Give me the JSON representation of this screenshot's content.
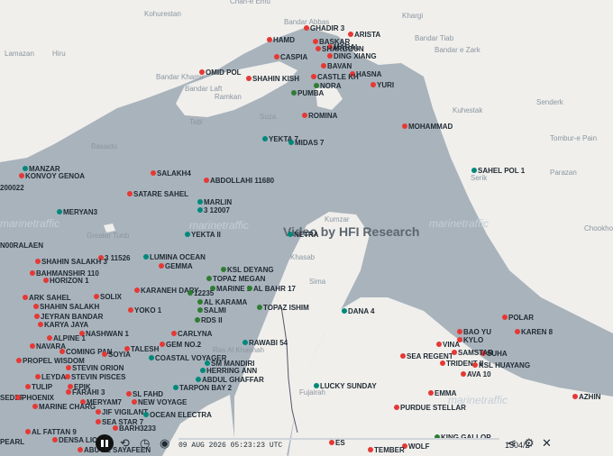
{
  "place_names": [
    "Chah-e Emu",
    "Kohurestan",
    "Lamazan",
    "Hiru",
    "Bandar Abbas",
    "Bandar Khamir",
    "Bandar Laft",
    "Ramkan",
    "Suza",
    "Tabl",
    "Basaidu",
    "Greater Tunb",
    "Khargi",
    "Bandar Tiab",
    "Bandar e Zark",
    "Kuhestak",
    "Senderk",
    "Tombur-e Pain",
    "Parazan",
    "Serik",
    "Kumzar",
    "Khasab",
    "Sima",
    "Ras Al Khaimah",
    "Fujairah",
    "Chookhor"
  ],
  "overlay": {
    "title": "Video by HFI Research",
    "watermark": "marinetraffic"
  },
  "ships": [
    {
      "name": "GHADIR 3",
      "color": "#e53935"
    },
    {
      "name": "ARISTA",
      "color": "#e53935"
    },
    {
      "name": "HAMD",
      "color": "#e53935"
    },
    {
      "name": "BASKAR",
      "color": "#e53935"
    },
    {
      "name": "MARAL",
      "color": "#e53935"
    },
    {
      "name": "SHARGOUN",
      "color": "#e53935"
    },
    {
      "name": "CASPIA",
      "color": "#e53935"
    },
    {
      "name": "DING XIANG",
      "color": "#e53935"
    },
    {
      "name": "BAVAN",
      "color": "#e53935"
    },
    {
      "name": "OMID POL",
      "color": "#e53935"
    },
    {
      "name": "HASNA",
      "color": "#e53935"
    },
    {
      "name": "SHAHIN KISH",
      "color": "#e53935"
    },
    {
      "name": "CASTLE KH",
      "color": "#e53935"
    },
    {
      "name": "YURI",
      "color": "#e53935"
    },
    {
      "name": "NORA",
      "color": "#2e7d32"
    },
    {
      "name": "PUMBA",
      "color": "#2e7d32"
    },
    {
      "name": "ROMINA",
      "color": "#e53935"
    },
    {
      "name": "MOHAMMAD",
      "color": "#e53935"
    },
    {
      "name": "YEKTA 7",
      "color": "#00897b"
    },
    {
      "name": "MIDAS 7",
      "color": "#00897b"
    },
    {
      "name": "MANZAR",
      "color": "#00897b"
    },
    {
      "name": "KONVOY GENOA",
      "color": "#e53935"
    },
    {
      "name": "200022",
      "color": "#00897b"
    },
    {
      "name": "SALAKH4",
      "color": "#e53935"
    },
    {
      "name": "ABDOLLAHI 11680",
      "color": "#e53935"
    },
    {
      "name": "SAHEL POL 1",
      "color": "#00897b"
    },
    {
      "name": "SATARE SAHEL",
      "color": "#e53935"
    },
    {
      "name": "MARLIN",
      "color": "#00897b"
    },
    {
      "name": "3 12007",
      "color": "#00897b"
    },
    {
      "name": "MERYAN3",
      "color": "#00897b"
    },
    {
      "name": "YEKTA II",
      "color": "#00897b"
    },
    {
      "name": "NETRA",
      "color": "#00897b"
    },
    {
      "name": "N00RALAEN",
      "color": "#e53935"
    },
    {
      "name": "3 11526",
      "color": "#e53935"
    },
    {
      "name": "LUMINA OCEAN",
      "color": "#00897b"
    },
    {
      "name": "GEMMA",
      "color": "#e53935"
    },
    {
      "name": "SHAHIN SALAKH 3",
      "color": "#e53935"
    },
    {
      "name": "BAHMANSHIR 110",
      "color": "#e53935"
    },
    {
      "name": "HORIZON 1",
      "color": "#e53935"
    },
    {
      "name": "KSL DEYANG",
      "color": "#2e7d32"
    },
    {
      "name": "TOPAZ MEGAN",
      "color": "#2e7d32"
    },
    {
      "name": "KARANEH DARY",
      "color": "#e53935"
    },
    {
      "name": "ARK SAHEL",
      "color": "#e53935"
    },
    {
      "name": "SOLIX",
      "color": "#e53935"
    },
    {
      "name": "MARINE 1",
      "color": "#2e7d32"
    },
    {
      "name": "AL BAHR 17",
      "color": "#2e7d32"
    },
    {
      "name": "12235",
      "color": "#2e7d32"
    },
    {
      "name": "SHAHIN SALAKH",
      "color": "#e53935"
    },
    {
      "name": "AL KARAMA",
      "color": "#2e7d32"
    },
    {
      "name": "TOPAZ ISHIM",
      "color": "#2e7d32"
    },
    {
      "name": "DANA 4",
      "color": "#00897b"
    },
    {
      "name": "JEYRAN BANDAR",
      "color": "#e53935"
    },
    {
      "name": "YOKO 1",
      "color": "#e53935"
    },
    {
      "name": "SALMI",
      "color": "#2e7d32"
    },
    {
      "name": "KARYA JAYA",
      "color": "#e53935"
    },
    {
      "name": "RDS II",
      "color": "#2e7d32"
    },
    {
      "name": "POLAR",
      "color": "#e53935"
    },
    {
      "name": "BAO YU",
      "color": "#e53935"
    },
    {
      "name": "NASHWAN 1",
      "color": "#e53935"
    },
    {
      "name": "CARLYNA",
      "color": "#e53935"
    },
    {
      "name": "KAREN 8",
      "color": "#e53935"
    },
    {
      "name": "ALPINE 1",
      "color": "#e53935"
    },
    {
      "name": "KYLO",
      "color": "#e53935"
    },
    {
      "name": "GEM NO.2",
      "color": "#e53935"
    },
    {
      "name": "RAWABI 54",
      "color": "#00897b"
    },
    {
      "name": "NAVARA",
      "color": "#e53935"
    },
    {
      "name": "VINA",
      "color": "#e53935"
    },
    {
      "name": "SUHA",
      "color": "#e53935"
    },
    {
      "name": "TALESH",
      "color": "#e53935"
    },
    {
      "name": "COMING PAN",
      "color": "#e53935"
    },
    {
      "name": "SOYIA",
      "color": "#e53935"
    },
    {
      "name": "SEA REGENT",
      "color": "#e53935"
    },
    {
      "name": "SAMSTAR",
      "color": "#e53935"
    },
    {
      "name": "PROPEL WISDOM",
      "color": "#e53935"
    },
    {
      "name": "COASTAL VOYAGER",
      "color": "#00897b"
    },
    {
      "name": "TRIDENT II",
      "color": "#e53935"
    },
    {
      "name": "KSL HUAYANG",
      "color": "#e53935"
    },
    {
      "name": "STEVIN ORION",
      "color": "#e53935"
    },
    {
      "name": "SM MANDIRI",
      "color": "#00897b"
    },
    {
      "name": "AVA 10",
      "color": "#e53935"
    },
    {
      "name": "HERRING ANN",
      "color": "#00897b"
    },
    {
      "name": "STEVIN PISCES",
      "color": "#e53935"
    },
    {
      "name": "ABDUL GHAFFAR",
      "color": "#00897b"
    },
    {
      "name": "LEYDA",
      "color": "#e53935"
    },
    {
      "name": "TARPON BAY 2",
      "color": "#00897b"
    },
    {
      "name": "LUCKY SUNDAY",
      "color": "#00897b"
    },
    {
      "name": "EPIK",
      "color": "#e53935"
    },
    {
      "name": "TULIP",
      "color": "#e53935"
    },
    {
      "name": "FARAHI 3",
      "color": "#e53935"
    },
    {
      "name": "EMMA",
      "color": "#e53935"
    },
    {
      "name": "AZHIN",
      "color": "#e53935"
    },
    {
      "name": "SEDEF",
      "color": "#e53935"
    },
    {
      "name": "PHOENIX",
      "color": "#e53935"
    },
    {
      "name": "SL FAHD",
      "color": "#e53935"
    },
    {
      "name": "MERYAM7",
      "color": "#e53935"
    },
    {
      "name": "NEW VOYAGE",
      "color": "#e53935"
    },
    {
      "name": "MARINE CHARG",
      "color": "#e53935"
    },
    {
      "name": "PURDUE STELLAR",
      "color": "#e53935"
    },
    {
      "name": "JIF VIGILANT",
      "color": "#e53935"
    },
    {
      "name": "OCEAN ELECTRA",
      "color": "#00897b"
    },
    {
      "name": "SEA STAR 7",
      "color": "#e53935"
    },
    {
      "name": "BARH3233",
      "color": "#e53935"
    },
    {
      "name": "AL FATTAN 9",
      "color": "#e53935"
    },
    {
      "name": "DENSA LION",
      "color": "#e53935"
    },
    {
      "name": "PEARL",
      "color": "#e53935"
    },
    {
      "name": "ABU AL SAYAFEEN",
      "color": "#e53935"
    },
    {
      "name": "WOLF",
      "color": "#e53935"
    },
    {
      "name": "KING GALLOP",
      "color": "#2e7d32"
    },
    {
      "name": "ES",
      "color": "#e53935"
    },
    {
      "name": "TEMBER",
      "color": "#e53935"
    }
  ],
  "player": {
    "timestamp": "09 AUG 2026 05:23:23 UTC",
    "progress": 0.0,
    "speed": "1304/2",
    "controls": [
      "play-pause",
      "rewind",
      "record",
      "share",
      "settings",
      "close"
    ]
  }
}
